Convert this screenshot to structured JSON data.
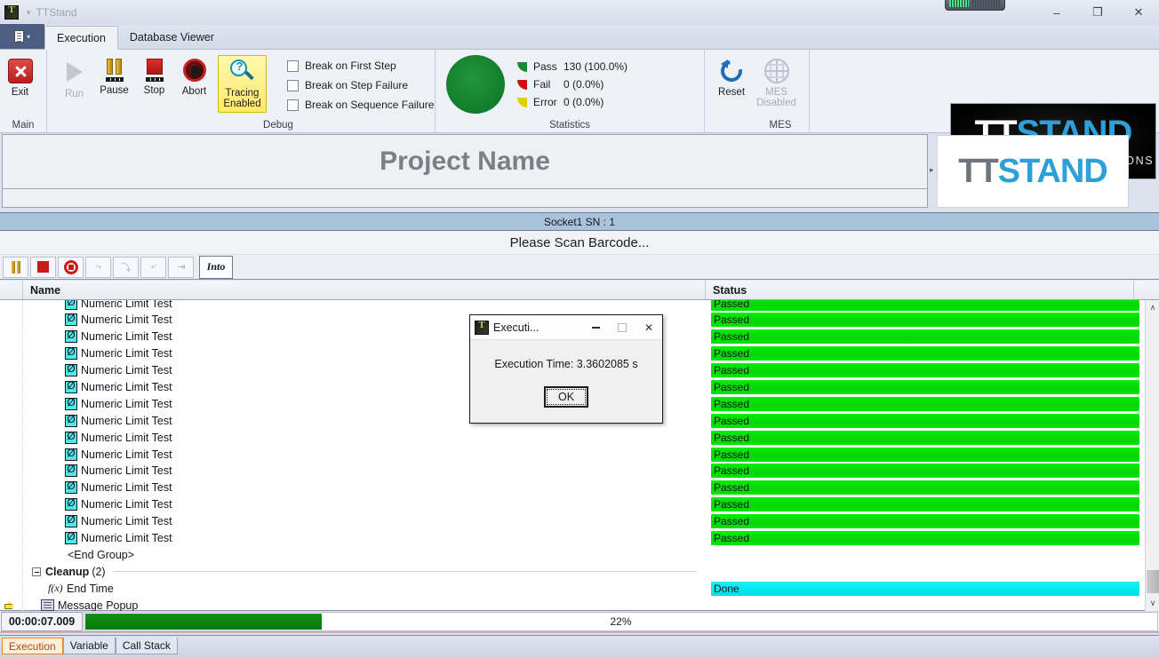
{
  "window": {
    "title": "TTStand",
    "app_icon": "ttstand-app-icon",
    "quick_access_caret": "▾",
    "minimize": "–",
    "restore": "❐",
    "close": "✕"
  },
  "ribbon": {
    "file_menu_caret": "▾",
    "tabs": [
      {
        "label": "Execution",
        "active": true
      },
      {
        "label": "Database Viewer",
        "active": false
      }
    ],
    "groups": [
      {
        "caption": "Main",
        "buttons": [
          {
            "label": "Exit",
            "icon": "exit-icon",
            "enabled": true
          }
        ]
      },
      {
        "caption": "Debug",
        "buttons": [
          {
            "label": "Run",
            "icon": "play-icon",
            "enabled": false
          },
          {
            "label": "Pause",
            "icon": "pause-icon",
            "enabled": true
          },
          {
            "label": "Stop",
            "icon": "stop-icon",
            "enabled": true
          },
          {
            "label": "Abort",
            "icon": "abort-hand-icon",
            "enabled": true
          },
          {
            "label": "Tracing\nEnabled",
            "label_line1": "Tracing",
            "label_line2": "Enabled",
            "icon": "magnifier-trace-icon",
            "enabled": true,
            "highlighted": true
          }
        ],
        "checkboxes": [
          {
            "label": "Break on First Step",
            "checked": false
          },
          {
            "label": "Break on Step Failure",
            "checked": false
          },
          {
            "label": "Break on Sequence Failure",
            "checked": false
          }
        ]
      },
      {
        "caption": "Statistics",
        "gauge_color": "#17883a",
        "rows": [
          {
            "name": "Pass",
            "value": "130 (100.0%)",
            "color": "#148c2e"
          },
          {
            "name": "Fail",
            "value": "0 (0.0%)",
            "color": "#cc1111"
          },
          {
            "name": "Error",
            "value": "0 (0.0%)",
            "color": "#e0d000"
          }
        ]
      },
      {
        "caption": "MES",
        "buttons": [
          {
            "label": "Reset",
            "icon": "reset-circular-arrow-icon",
            "enabled": true
          },
          {
            "label_line1": "MES",
            "label_line2": "Disabled",
            "icon": "globe-icon",
            "enabled": false
          }
        ]
      }
    ]
  },
  "brand_logo": {
    "text_white": "TT",
    "text_blue": "STAND",
    "tagline": "AUTOMATED TEST SOLUTIONS"
  },
  "project": {
    "title": "Project Name",
    "expand_caret": "▸",
    "logo_grey": "TT",
    "logo_blue": "STAND"
  },
  "socket": {
    "label": "Socket1 SN : 1",
    "prompt": "Please Scan Barcode..."
  },
  "exec_toolbar": {
    "buttons": [
      {
        "icon": "pause-icon",
        "enabled": true
      },
      {
        "icon": "stop-icon",
        "enabled": true
      },
      {
        "icon": "abort-icon",
        "enabled": true
      },
      {
        "icon": "step-over-icon",
        "enabled": false
      },
      {
        "icon": "step-into-icon",
        "enabled": false
      },
      {
        "icon": "step-out-icon",
        "enabled": false
      },
      {
        "icon": "run-to-cursor-icon",
        "enabled": false
      }
    ],
    "into_label": "Into"
  },
  "grid": {
    "columns": [
      "",
      "Name",
      "Status"
    ],
    "rows": [
      {
        "type": "test",
        "icon": "numeric-limit-test-icon",
        "name": "Numeric Limit Test",
        "status": "Passed",
        "status_kind": "pass",
        "clipped": true
      },
      {
        "type": "test",
        "icon": "numeric-limit-test-icon",
        "name": "Numeric Limit Test",
        "status": "Passed",
        "status_kind": "pass"
      },
      {
        "type": "test",
        "icon": "numeric-limit-test-icon",
        "name": "Numeric Limit Test",
        "status": "Passed",
        "status_kind": "pass"
      },
      {
        "type": "test",
        "icon": "numeric-limit-test-icon",
        "name": "Numeric Limit Test",
        "status": "Passed",
        "status_kind": "pass"
      },
      {
        "type": "test",
        "icon": "numeric-limit-test-icon",
        "name": "Numeric Limit Test",
        "status": "Passed",
        "status_kind": "pass"
      },
      {
        "type": "test",
        "icon": "numeric-limit-test-icon",
        "name": "Numeric Limit Test",
        "status": "Passed",
        "status_kind": "pass"
      },
      {
        "type": "test",
        "icon": "numeric-limit-test-icon",
        "name": "Numeric Limit Test",
        "status": "Passed",
        "status_kind": "pass"
      },
      {
        "type": "test",
        "icon": "numeric-limit-test-icon",
        "name": "Numeric Limit Test",
        "status": "Passed",
        "status_kind": "pass"
      },
      {
        "type": "test",
        "icon": "numeric-limit-test-icon",
        "name": "Numeric Limit Test",
        "status": "Passed",
        "status_kind": "pass"
      },
      {
        "type": "test",
        "icon": "numeric-limit-test-icon",
        "name": "Numeric Limit Test",
        "status": "Passed",
        "status_kind": "pass"
      },
      {
        "type": "test",
        "icon": "numeric-limit-test-icon",
        "name": "Numeric Limit Test",
        "status": "Passed",
        "status_kind": "pass"
      },
      {
        "type": "test",
        "icon": "numeric-limit-test-icon",
        "name": "Numeric Limit Test",
        "status": "Passed",
        "status_kind": "pass"
      },
      {
        "type": "test",
        "icon": "numeric-limit-test-icon",
        "name": "Numeric Limit Test",
        "status": "Passed",
        "status_kind": "pass"
      },
      {
        "type": "test",
        "icon": "numeric-limit-test-icon",
        "name": "Numeric Limit Test",
        "status": "Passed",
        "status_kind": "pass"
      },
      {
        "type": "test",
        "icon": "numeric-limit-test-icon",
        "name": "Numeric Limit Test",
        "status": "Passed",
        "status_kind": "pass"
      },
      {
        "type": "endgroup",
        "name": "<End Group>",
        "status": "",
        "status_kind": "none"
      },
      {
        "type": "group",
        "name": "Cleanup",
        "count": "(2)",
        "status": "",
        "status_kind": "none",
        "expanded": true
      },
      {
        "type": "fx",
        "icon": "function-icon",
        "name": "End Time",
        "status": "Done",
        "status_kind": "done"
      },
      {
        "type": "message",
        "icon": "message-popup-icon",
        "name": "Message Popup",
        "status": "",
        "status_kind": "none",
        "current": true
      }
    ],
    "scrollbar": {
      "up": "∧",
      "down": "∨"
    }
  },
  "status_bar": {
    "elapsed": "00:00:07.009",
    "progress_percent": 22,
    "progress_label": "22%",
    "progress_color": "#0d8a0d"
  },
  "bottom_tabs": [
    {
      "label": "Execution",
      "active": true
    },
    {
      "label": "Variable",
      "active": false
    },
    {
      "label": "Call Stack",
      "active": false
    }
  ],
  "dialog": {
    "title": "Executi...",
    "icon": "ttstand-app-icon",
    "message": "Execution Time: 3.3602085 s",
    "ok_label": "OK",
    "minimize": "–",
    "maximize": "❐",
    "close": "✕"
  }
}
